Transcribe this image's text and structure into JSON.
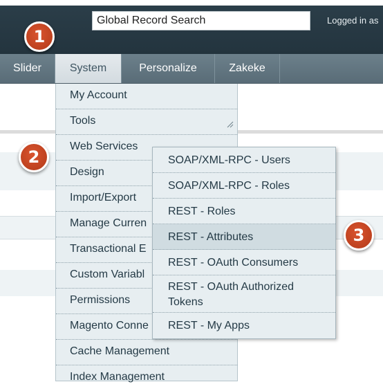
{
  "header": {
    "search_value": "Global Record Search",
    "logged_in_text": "Logged in as"
  },
  "nav": {
    "items": [
      {
        "label": "Slider"
      },
      {
        "label": "System"
      },
      {
        "label": "Personalize"
      },
      {
        "label": "Zakeke"
      }
    ]
  },
  "system_menu": {
    "items": [
      {
        "label": "My Account"
      },
      {
        "label": "Tools"
      },
      {
        "label": "Web Services"
      },
      {
        "label": "Design"
      },
      {
        "label": "Import/Export"
      },
      {
        "label": "Manage Curren"
      },
      {
        "label": "Transactional E"
      },
      {
        "label": "Custom Variabl"
      },
      {
        "label": "Permissions"
      },
      {
        "label": "Magento Conne"
      },
      {
        "label": "Cache Management"
      },
      {
        "label": "Index Management"
      }
    ]
  },
  "web_services_submenu": {
    "items": [
      {
        "label": "SOAP/XML-RPC - Users"
      },
      {
        "label": "SOAP/XML-RPC - Roles"
      },
      {
        "label": "REST - Roles"
      },
      {
        "label": "REST - Attributes"
      },
      {
        "label": "REST - OAuth Consumers"
      },
      {
        "label": "REST - OAuth Authorized Tokens"
      },
      {
        "label": "REST - My Apps"
      }
    ]
  },
  "badges": [
    "1",
    "2",
    "3"
  ],
  "colors": {
    "header_bg": "#2c3f4a",
    "nav_bg": "#6c808b",
    "menu_bg": "#e7eef1",
    "highlight_bg": "#d0dce1",
    "badge": "#c2451f"
  }
}
